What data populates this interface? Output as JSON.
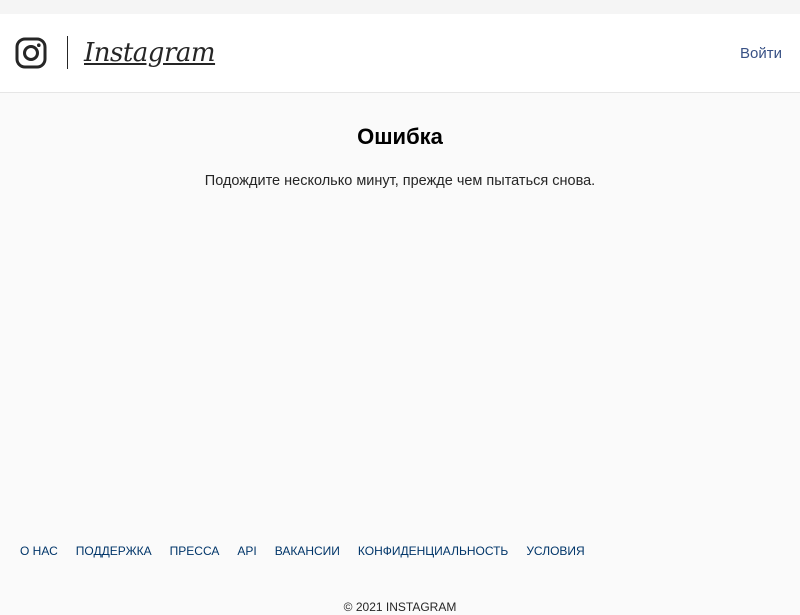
{
  "header": {
    "logo_icon": "instagram-camera-icon",
    "wordmark": "Instagram",
    "login_label": "Войти"
  },
  "main": {
    "title": "Ошибка",
    "message": "Подождите несколько минут, прежде чем пытаться снова."
  },
  "footer": {
    "links": [
      "О НАС",
      "ПОДДЕРЖКА",
      "ПРЕССА",
      "API",
      "ВАКАНСИИ",
      "КОНФИДЕНЦИАЛЬНОСТЬ",
      "УСЛОВИЯ"
    ],
    "copyright": "© 2021 INSTAGRAM"
  },
  "colors": {
    "background": "#fafafa",
    "header_background": "#ffffff",
    "link": "#385185",
    "footer_link": "#003569",
    "text": "#262626"
  }
}
